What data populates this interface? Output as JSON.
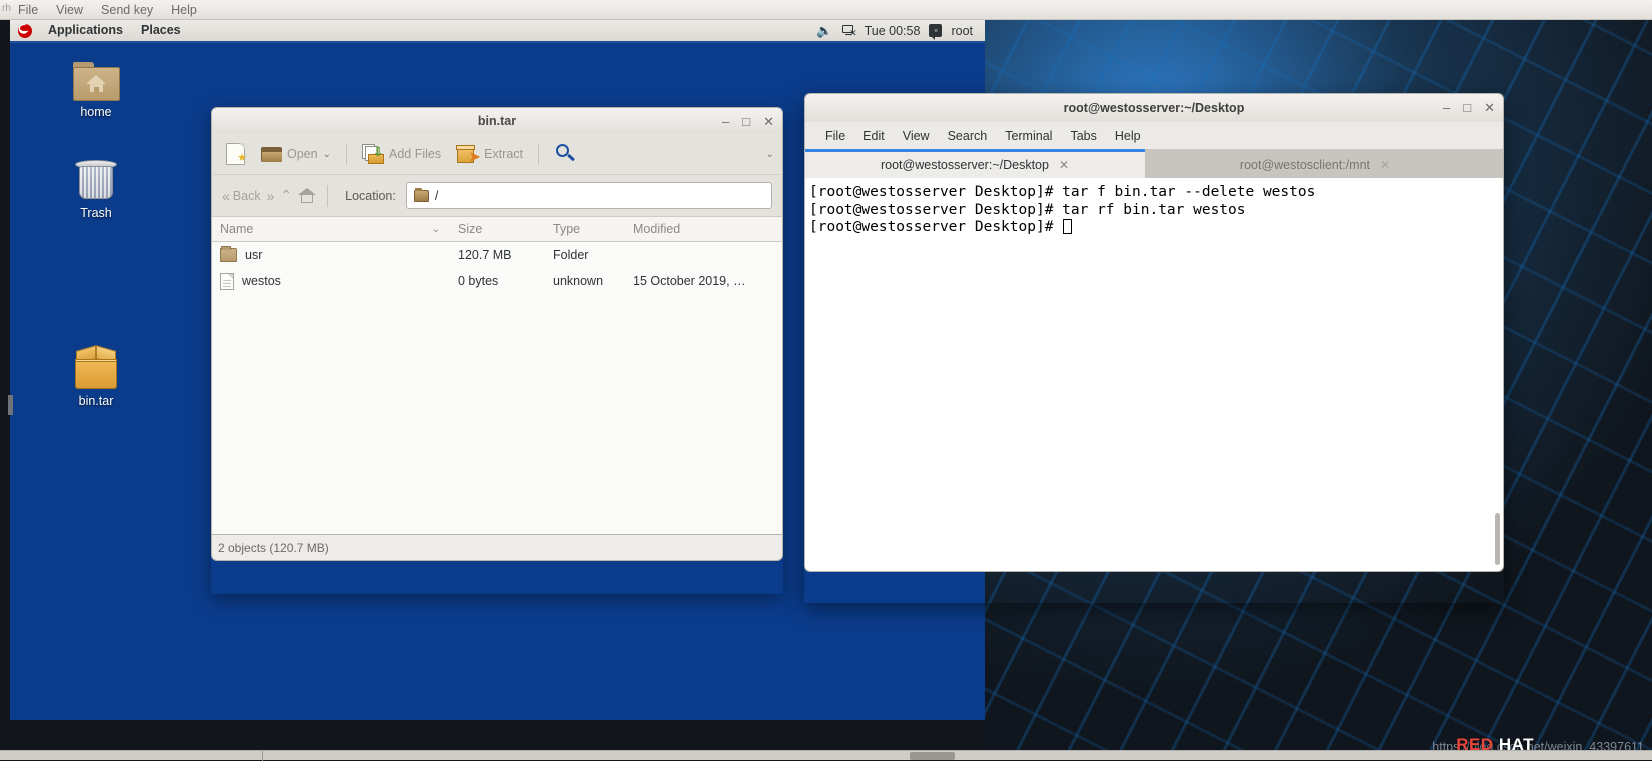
{
  "host": {
    "left_label": "rh",
    "menu": [
      "File",
      "View",
      "Send key",
      "Help"
    ]
  },
  "panel": {
    "applications": "Applications",
    "places": "Places",
    "clock": "Tue 00:58",
    "user": "root",
    "volume_icon": "volume-icon",
    "network_icon": "network-disconnected-icon",
    "logo_icon": "redhat-logo-icon"
  },
  "desktop": {
    "icons": [
      {
        "label": "home",
        "icon": "home-folder-icon"
      },
      {
        "label": "Trash",
        "icon": "trash-icon"
      },
      {
        "label": "bin.tar",
        "icon": "archive-icon"
      }
    ]
  },
  "file_manager": {
    "title": "bin.tar",
    "window_buttons": {
      "minimize": "–",
      "maximize": "□",
      "close": "✕"
    },
    "toolbar": {
      "new_label": "",
      "open_label": "Open",
      "open_chevron": "⌄",
      "add_files_label": "Add Files",
      "extract_label": "Extract",
      "search_label": "",
      "menu_chevron": "⌄"
    },
    "navbar": {
      "back_label": "Back",
      "back_icon": "«",
      "forward_icon": "»",
      "up_icon": "⌃",
      "home_icon": "home-icon",
      "location_label": "Location:",
      "location_value": "/"
    },
    "columns": [
      "Name",
      "Size",
      "Type",
      "Modified"
    ],
    "sort_chevron": "⌄",
    "rows": [
      {
        "icon": "folder-icon",
        "name": "usr",
        "size": "120.7 MB",
        "type": "Folder",
        "modified": ""
      },
      {
        "icon": "file-icon",
        "name": "westos",
        "size": "0 bytes",
        "type": "unknown",
        "modified": "15 October 2019, …"
      }
    ],
    "status": "2 objects (120.7 MB)"
  },
  "terminal": {
    "title": "root@westosserver:~/Desktop",
    "window_buttons": {
      "minimize": "–",
      "maximize": "□",
      "close": "✕"
    },
    "menu": [
      "File",
      "Edit",
      "View",
      "Search",
      "Terminal",
      "Tabs",
      "Help"
    ],
    "tabs": [
      {
        "label": "root@westosserver:~/Desktop",
        "close": "✕",
        "active": true
      },
      {
        "label": "root@westosclient:/mnt",
        "close": "✕",
        "active": false
      }
    ],
    "lines": [
      "[root@westosserver Desktop]# tar f bin.tar --delete westos",
      "[root@westosserver Desktop]# tar rf bin.tar westos",
      "[root@westosserver Desktop]# "
    ]
  },
  "watermark": {
    "url": "https://blog.csdn.net/weixin_43397611",
    "brand_red": "RED",
    "brand_rest": " HAT"
  },
  "colors": {
    "desktop_blue": "#0b3c8c",
    "panel_accent": "#1b4f9c",
    "tab_accent": "#3584e4",
    "redhat_red": "#cc0000"
  }
}
